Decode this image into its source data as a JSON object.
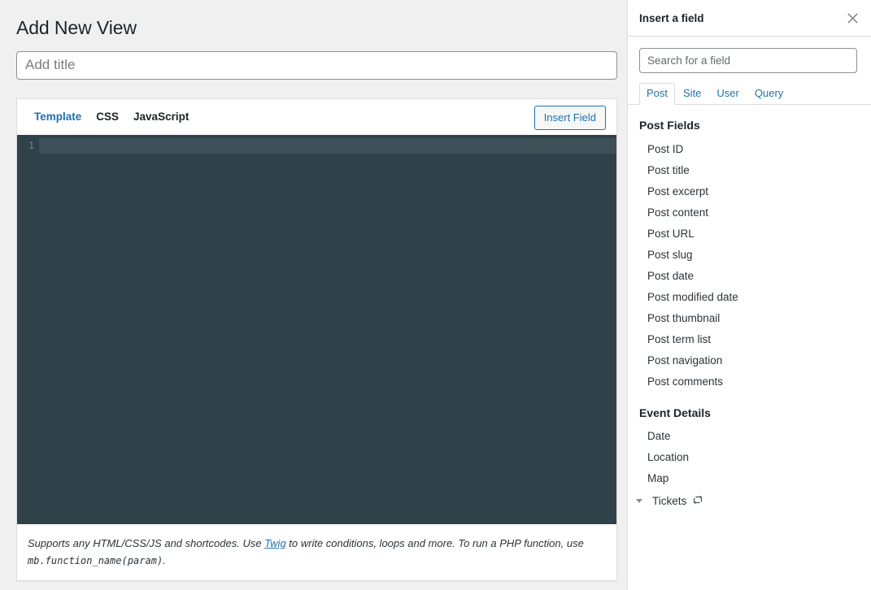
{
  "main": {
    "page_title": "Add New View",
    "title_input": {
      "value": "",
      "placeholder": "Add title"
    },
    "editor": {
      "tabs": [
        {
          "label": "Template",
          "active": true
        },
        {
          "label": "CSS",
          "active": false
        },
        {
          "label": "JavaScript",
          "active": false
        }
      ],
      "insert_field_label": "Insert Field",
      "line_numbers": [
        "1"
      ],
      "code_value": "",
      "colors": {
        "editor_background": "#2f4249",
        "active_line": "#3d4f57",
        "gutter_number": "#74868e"
      }
    },
    "footer": {
      "text_part1": "Supports any HTML/CSS/JS and shortcodes. Use ",
      "link_label": "Twig",
      "text_part2": " to write conditions, loops and more. To run a PHP function, use ",
      "code_label": "mb.function_name(param)",
      "text_part3": "."
    }
  },
  "side_panel": {
    "title": "Insert a field",
    "close_icon": "close-icon",
    "search": {
      "value": "",
      "placeholder": "Search for a field"
    },
    "tabs": [
      {
        "label": "Post",
        "active": true
      },
      {
        "label": "Site",
        "active": false
      },
      {
        "label": "User",
        "active": false
      },
      {
        "label": "Query",
        "active": false
      }
    ],
    "groups": [
      {
        "title": "Post Fields",
        "fields": [
          {
            "label": "Post ID"
          },
          {
            "label": "Post title"
          },
          {
            "label": "Post excerpt"
          },
          {
            "label": "Post content"
          },
          {
            "label": "Post URL"
          },
          {
            "label": "Post slug"
          },
          {
            "label": "Post date"
          },
          {
            "label": "Post modified date"
          },
          {
            "label": "Post thumbnail"
          },
          {
            "label": "Post term list"
          },
          {
            "label": "Post navigation"
          },
          {
            "label": "Post comments"
          }
        ]
      },
      {
        "title": "Event Details",
        "fields": [
          {
            "label": "Date"
          },
          {
            "label": "Location"
          },
          {
            "label": "Map"
          },
          {
            "label": "Tickets",
            "caret": true,
            "icon": "repeat-icon"
          }
        ]
      }
    ]
  },
  "colors": {
    "accent": "#2271b1",
    "page_background": "#f0f0f1",
    "panel_background": "#ffffff",
    "border": "#dcdcde",
    "text": "#1d2327"
  }
}
